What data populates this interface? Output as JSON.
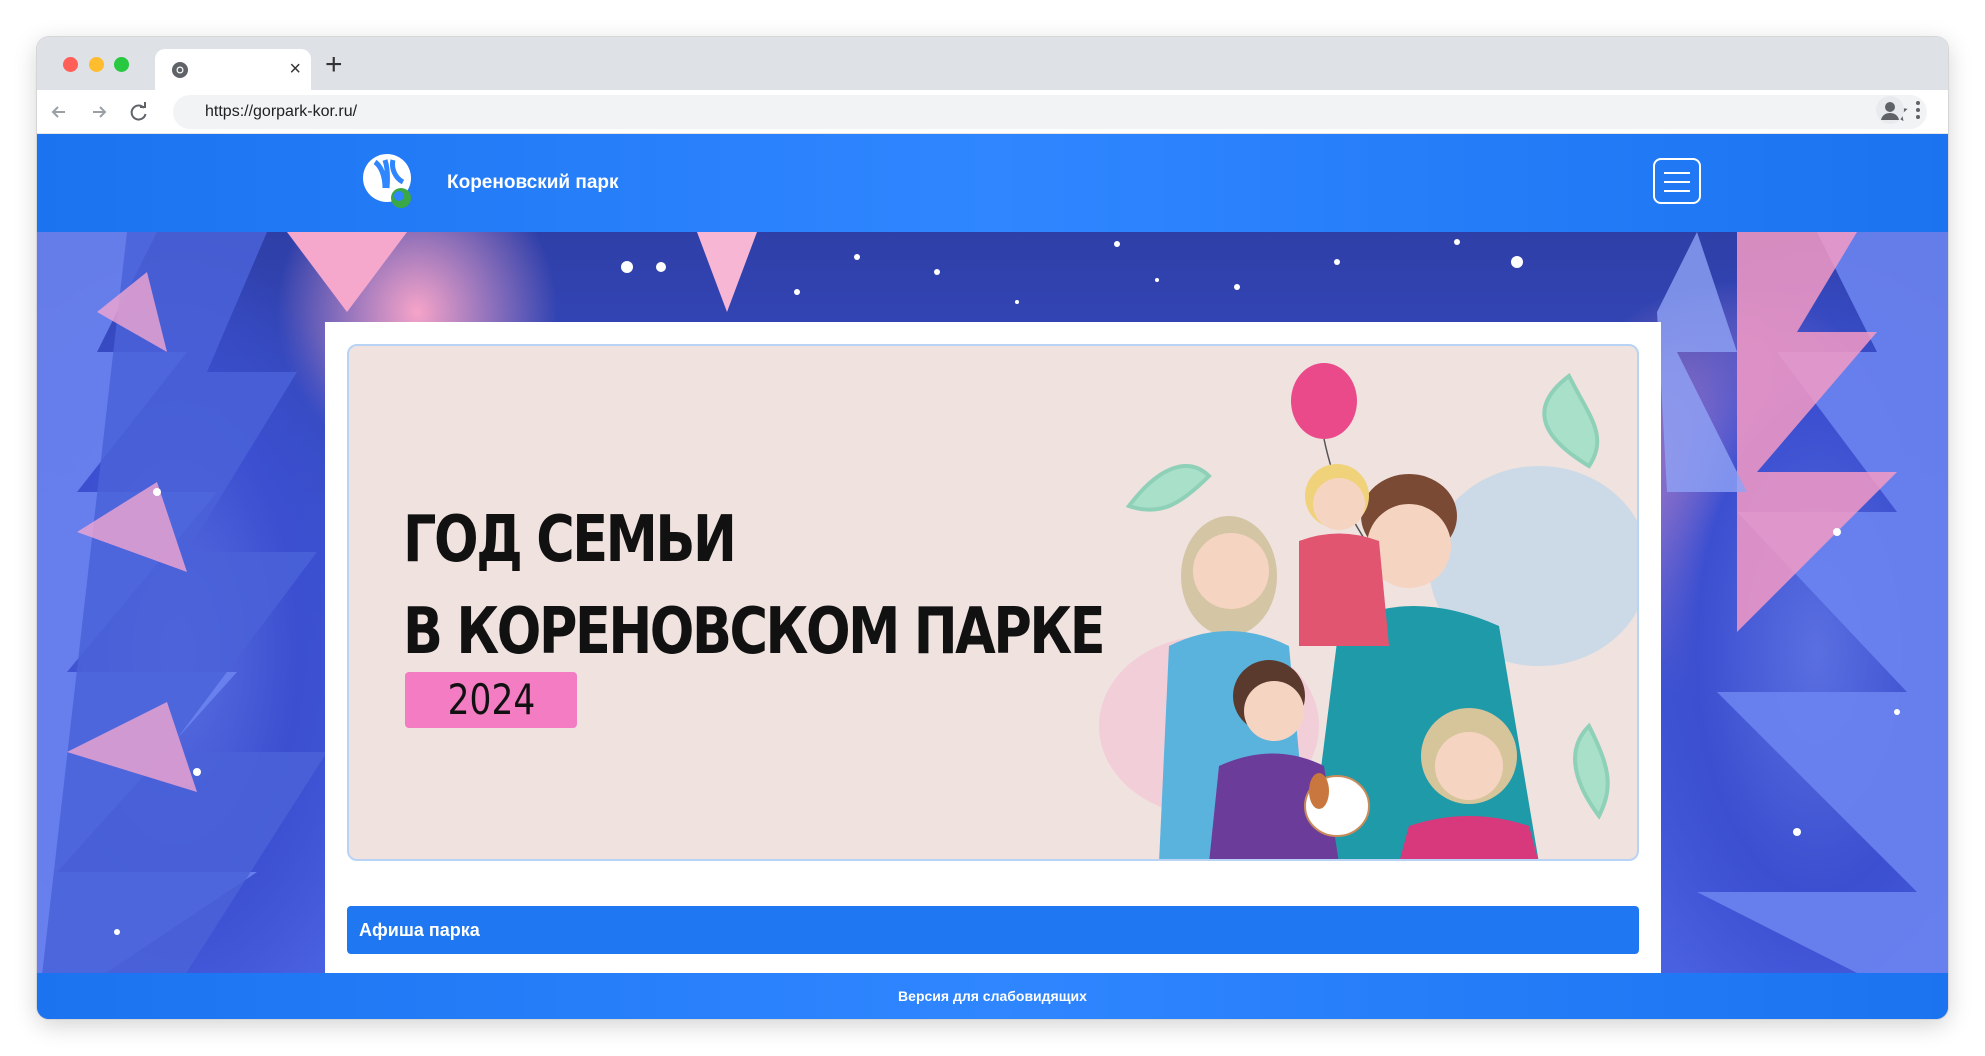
{
  "browser": {
    "url": "https://gorpark-kor.ru/",
    "tab_close": "×",
    "new_tab": "+"
  },
  "site": {
    "title": "Кореновский парк"
  },
  "banner": {
    "line1": "ГОД СЕМЬИ",
    "line2": "В КОРЕНОВСКОМ ПАРКЕ",
    "year": "2024"
  },
  "afisha": {
    "label": "Афиша парка"
  },
  "footer": {
    "label": "Версия для слабовидящих"
  },
  "colors": {
    "header_blue": "#2f86ff",
    "year_badge": "#f37cc2",
    "banner_bg": "#efe2df"
  },
  "icons": [
    "chrome-icon",
    "back-arrow-icon",
    "forward-arrow-icon",
    "reload-icon",
    "star-icon",
    "profile-icon",
    "kebab-menu-icon",
    "hamburger-menu-icon",
    "park-logo-icon"
  ]
}
